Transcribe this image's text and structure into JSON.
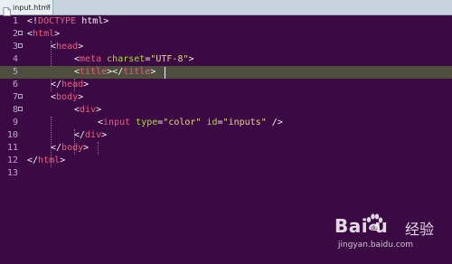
{
  "tab": {
    "label": "input.html",
    "close_glyph": "×",
    "icon": "file-icon"
  },
  "editor": {
    "current_line": 5,
    "lines": [
      {
        "num": "1",
        "text": ""
      },
      {
        "num": "2",
        "text": ""
      },
      {
        "num": "3",
        "text": ""
      },
      {
        "num": "4",
        "text": ""
      },
      {
        "num": "5",
        "text": ""
      },
      {
        "num": "6",
        "text": ""
      },
      {
        "num": "7",
        "text": ""
      },
      {
        "num": "8",
        "text": ""
      },
      {
        "num": "9",
        "text": ""
      },
      {
        "num": "10",
        "text": ""
      },
      {
        "num": "11",
        "text": ""
      },
      {
        "num": "12",
        "text": ""
      },
      {
        "num": "13",
        "text": ""
      }
    ],
    "tokens": {
      "l1_open": "<!",
      "l1_kw": "DOCTYPE",
      "l1_rest": " html>",
      "lt": "<",
      "gt": ">",
      "lt_slash": "</",
      "html": "html",
      "head": "head",
      "meta": "meta",
      "charset": "charset",
      "eq": "=",
      "utf8": "\"UTF-8\"",
      "title": "title",
      "body": "body",
      "div": "div",
      "input": "input",
      "type": "type",
      "color_val": "\"color\"",
      "id": "id",
      "inputs_val": "\"inputs\"",
      "self_close": " />"
    }
  },
  "watermark": {
    "logo": "Bai  u",
    "cn": "经验",
    "url": "jingyan.baidu.com"
  },
  "colors": {
    "background": "#3b0a44",
    "tag": "#f25b7d",
    "attr": "#a6e22e",
    "string": "#e6db74",
    "current_line": "#4e4e3e"
  }
}
